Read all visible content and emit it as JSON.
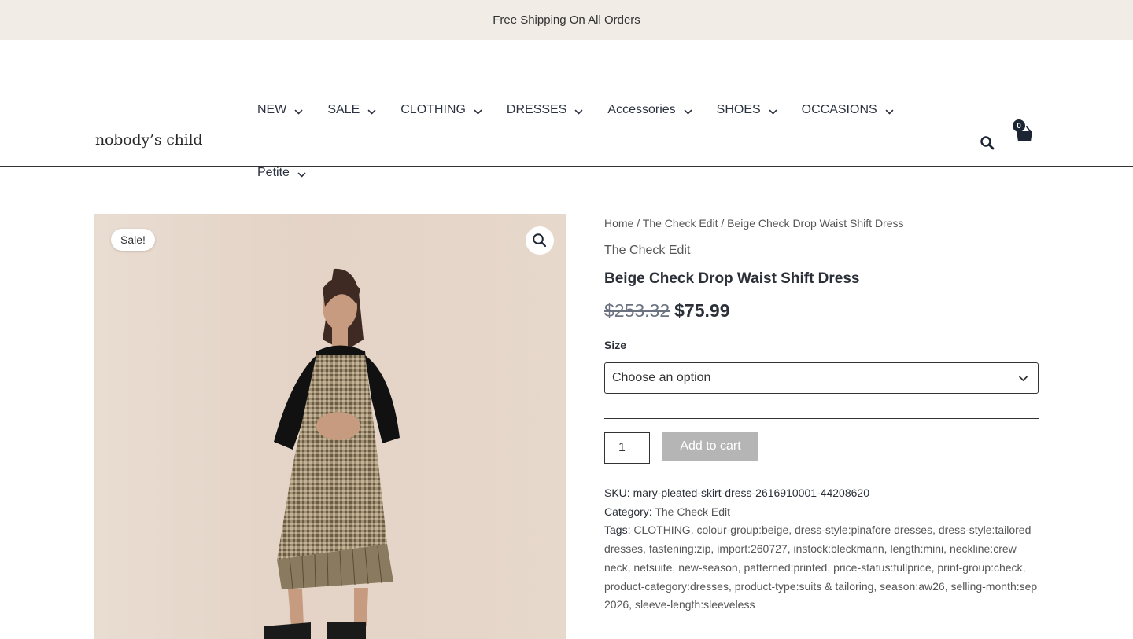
{
  "announcement": "Free Shipping On All Orders",
  "logo": "nobody’s child",
  "nav": {
    "row1": [
      "NEW",
      "SALE",
      "CLOTHING",
      "DRESSES",
      "Accessories",
      "SHOES",
      "OCCASIONS"
    ],
    "row2": [
      "Petite"
    ]
  },
  "cart": {
    "count": "0"
  },
  "gallery": {
    "badge": "Sale!"
  },
  "breadcrumb": {
    "home": "Home",
    "sep": " / ",
    "collection": "The Check Edit",
    "current": "Beige Check Drop Waist Shift Dress"
  },
  "product": {
    "collection": "The Check Edit",
    "title": "Beige Check Drop Waist Shift Dress",
    "old_price": "$253.32",
    "price": "$75.99",
    "size_label": "Size",
    "size_placeholder": "Choose an option",
    "quantity": "1",
    "add_to_cart": "Add to cart"
  },
  "meta": {
    "sku_label": "SKU:",
    "sku": "mary-pleated-skirt-dress-2616910001-44208620",
    "category_label": "Category:",
    "category": "The Check Edit",
    "tags_label": "Tags:",
    "tags": [
      "CLOTHING",
      "colour-group:beige",
      "dress-style:pinafore dresses",
      "dress-style:tailored dresses",
      "fastening:zip",
      "import:260727",
      "instock:bleckmann",
      "length:mini",
      "neckline:crew neck",
      "netsuite",
      "new-season",
      "patterned:printed",
      "price-status:fullprice",
      "print-group:check",
      "product-category:dresses",
      "product-type:suits & tailoring",
      "season:aw26",
      "selling-month:sep 2026",
      "sleeve-length:sleeveless"
    ]
  },
  "colors": {
    "announce_bg": "#f1ede6",
    "text": "#2b2f38",
    "button_disabled": "#b5b5b5"
  }
}
